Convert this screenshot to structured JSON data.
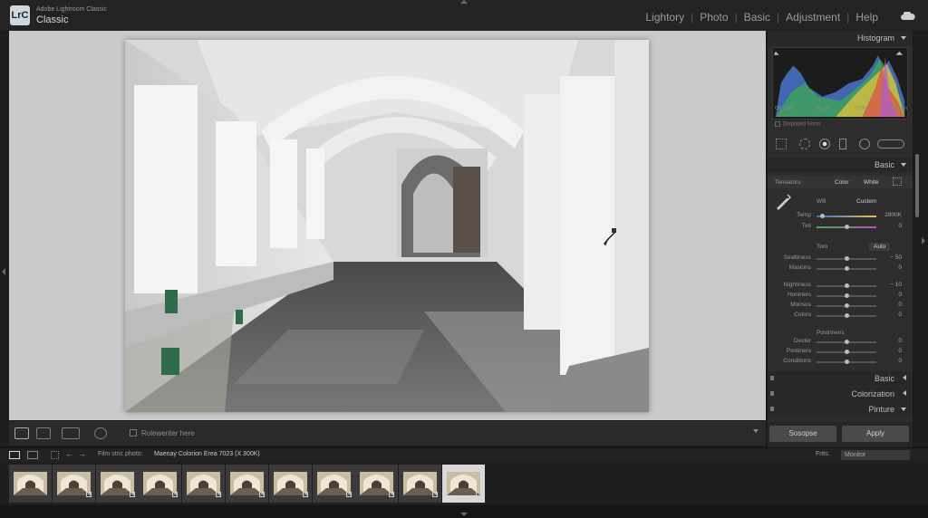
{
  "app": {
    "logo": "LrC",
    "subtitle": "Adobe Lightroom Classic",
    "title": "Classic"
  },
  "modules": [
    "Lightory",
    "Photo",
    "Basic",
    "Adjustment",
    "Help"
  ],
  "toolbar": {
    "label": "Roleweriter here"
  },
  "panel": {
    "histogram": {
      "title": "Histogram",
      "info": [
        "Od 3.80",
        "Allo 80",
        "77/96",
        "Mitugen"
      ],
      "checkbox_label": "Displated Norm"
    },
    "basic": {
      "title": "Basic",
      "profile_label": "Tenoators",
      "profile_tabs": [
        "Color",
        "White"
      ],
      "wb_label": "WB",
      "wb_value": "Custem",
      "temp": {
        "label": "Temp",
        "value": "2800K",
        "pos": 0.1
      },
      "tint": {
        "label": "Tint",
        "value": "0",
        "pos": 0.5
      },
      "tone_label": "Tom",
      "auto_label": "Auto",
      "group1": [
        {
          "label": "Seattiness",
          "value": "− 50",
          "pos": 0.5
        },
        {
          "label": "Masions",
          "value": "0",
          "pos": 0.5
        }
      ],
      "group2": [
        {
          "label": "Nightiness",
          "value": "− 10",
          "pos": 0.5
        },
        {
          "label": "Honiners",
          "value": "0",
          "pos": 0.5
        },
        {
          "label": "Monsos",
          "value": "0",
          "pos": 0.5
        },
        {
          "label": "Colors",
          "value": "0",
          "pos": 0.5
        }
      ],
      "presence_label": "Postnnens",
      "group3": [
        {
          "label": "Decter",
          "value": "0",
          "pos": 0.5
        },
        {
          "label": "Pestiners",
          "value": "0",
          "pos": 0.5
        },
        {
          "label": "Conditions",
          "value": "0",
          "pos": 0.5
        }
      ]
    },
    "collapsed": [
      "Basic",
      "Colorization",
      "Pinture"
    ],
    "buttons": {
      "left": "Sosopse",
      "right": "Apply"
    }
  },
  "filmstrip": {
    "source_label": "Film stric photo:",
    "source_value": "Maenay Colorion Erea 7023 (X 300K)",
    "filter_label": "Frits:",
    "filter_value": "Monitor",
    "thumb_count": 11,
    "selected_index": 10
  },
  "colors": {
    "accent": "#d9d9d9",
    "panel_bg": "#2d2d2d",
    "canvas_bg": "#cacaca"
  },
  "icons": [
    "cloud-icon",
    "eyedropper-icon",
    "grid-view-icon",
    "loupe-view-icon",
    "compare-view-icon",
    "crop-icon",
    "spot-removal-icon",
    "redeye-icon",
    "gradient-icon",
    "radial-icon",
    "brush-icon"
  ]
}
